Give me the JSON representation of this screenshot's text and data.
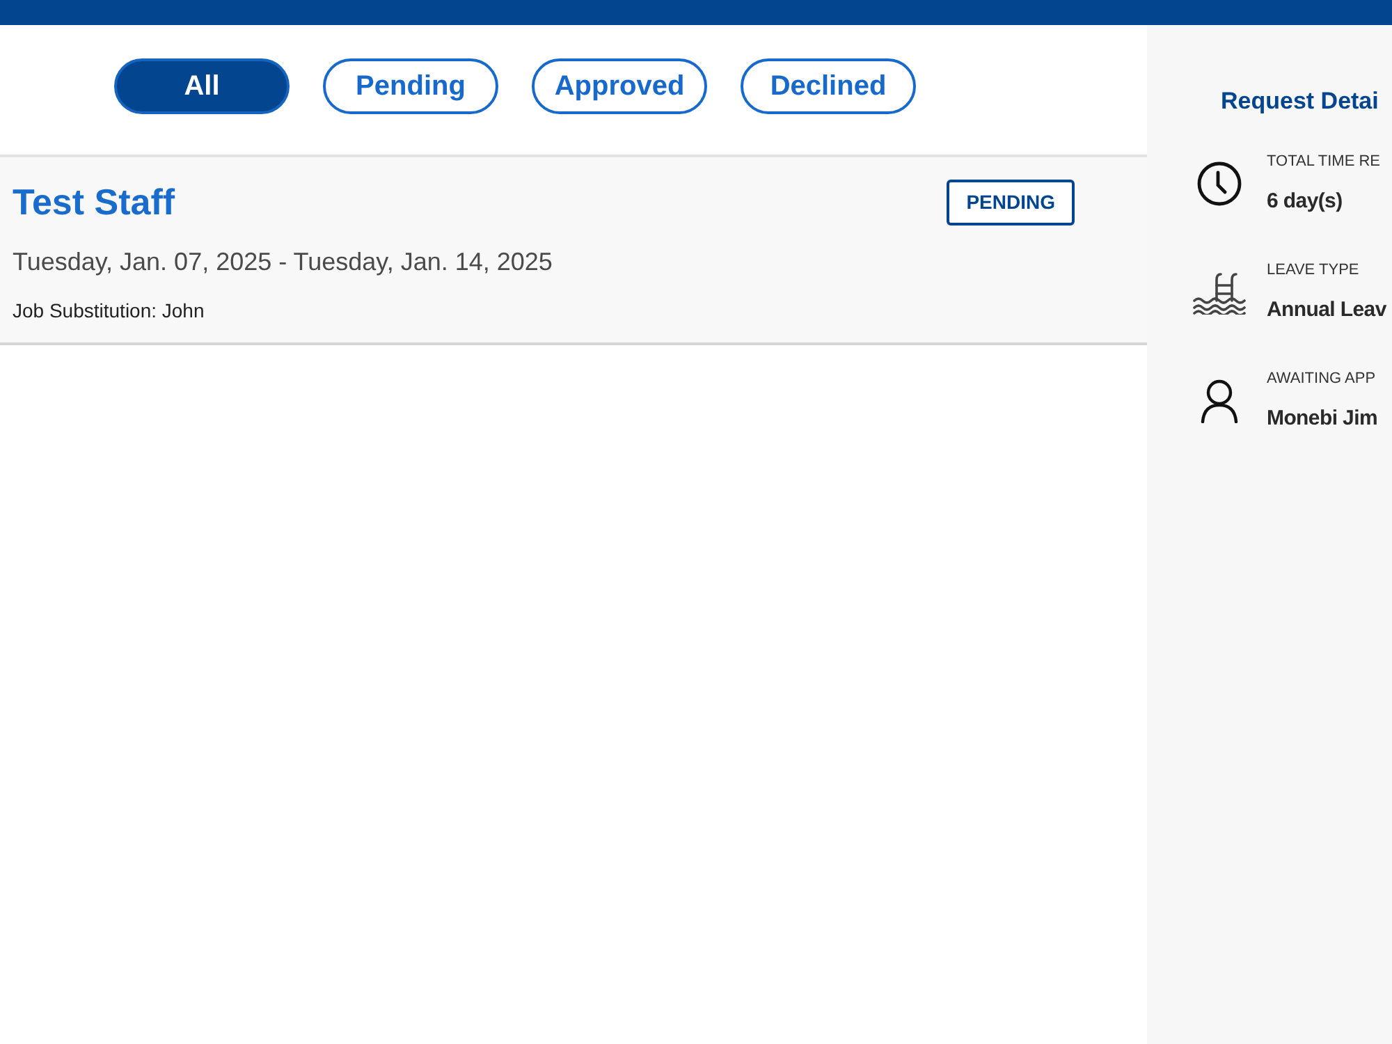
{
  "filters": [
    {
      "label": "All",
      "selected": true
    },
    {
      "label": "Pending",
      "selected": false
    },
    {
      "label": "Approved",
      "selected": false
    },
    {
      "label": "Declined",
      "selected": false
    }
  ],
  "requests": [
    {
      "name": "Test Staff",
      "status": "PENDING",
      "dates": "Tuesday, Jan. 07, 2025 - Tuesday, Jan. 14, 2025",
      "substitution": "Job Substitution: John"
    }
  ],
  "details_panel": {
    "title": "Request Detai",
    "items": [
      {
        "kind": "clock",
        "label": "TOTAL TIME RE",
        "value": "6 day(s)"
      },
      {
        "kind": "pool",
        "label": "LEAVE TYPE",
        "value": "Annual Leav"
      },
      {
        "kind": "person",
        "label": "AWAITING APP",
        "value": "Monebi Jim"
      }
    ]
  }
}
